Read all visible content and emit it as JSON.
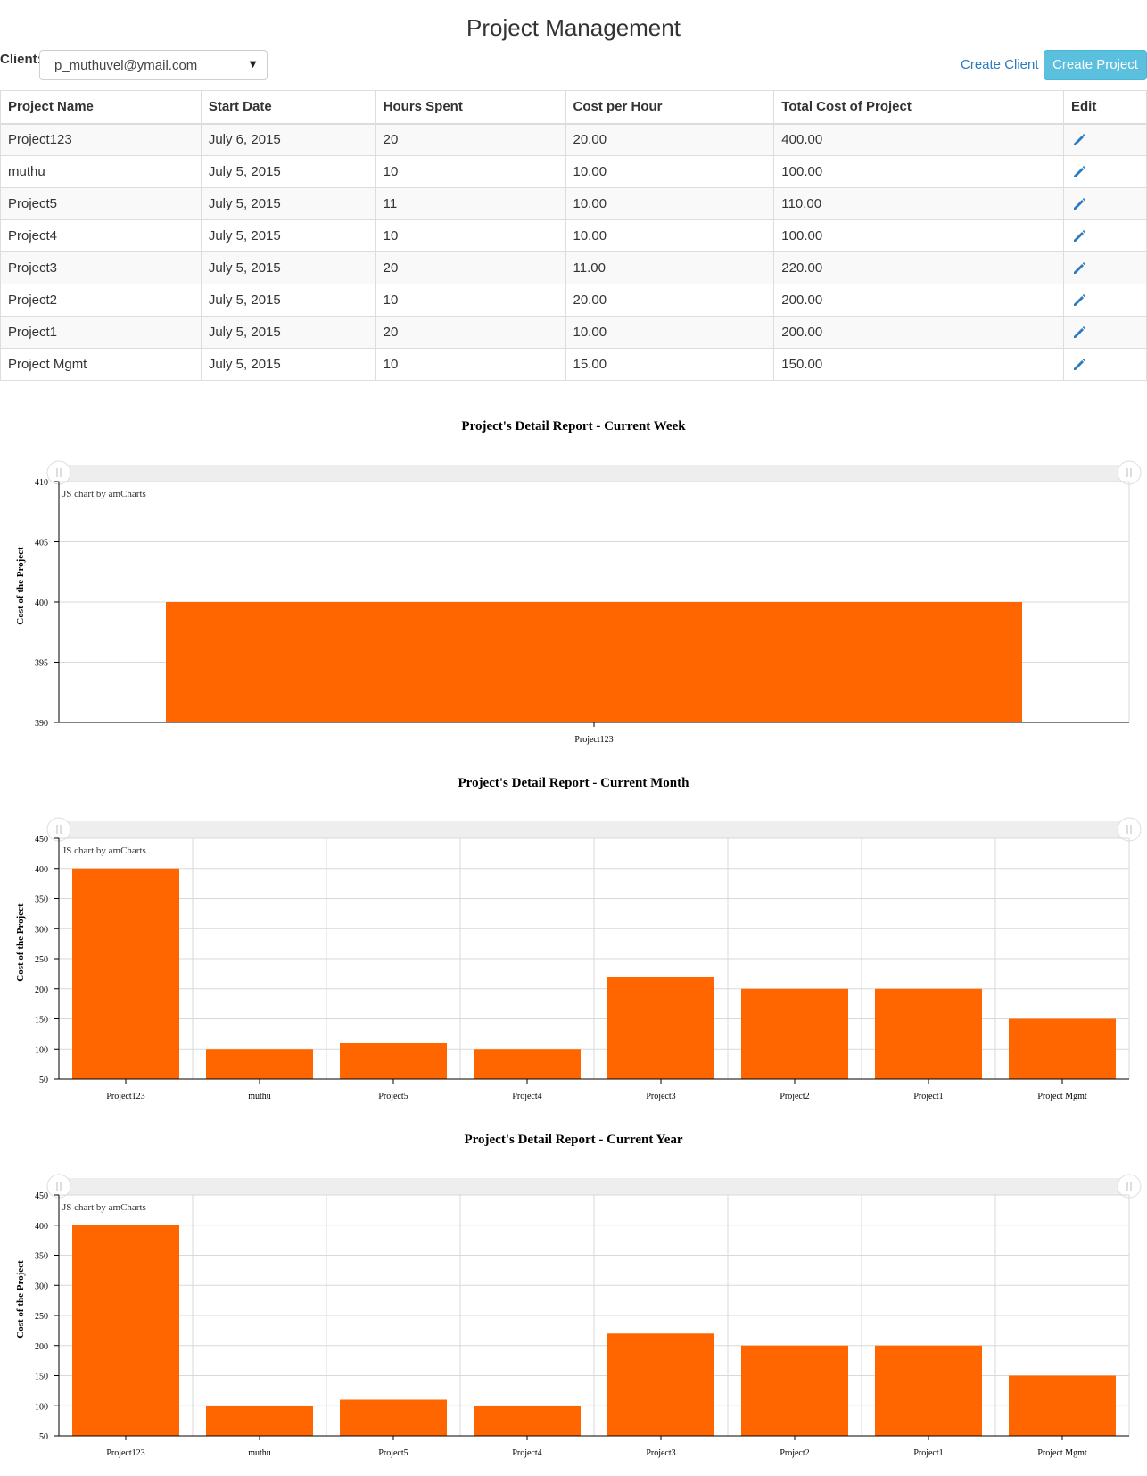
{
  "header": {
    "title": "Project Management"
  },
  "client": {
    "label": "Client:",
    "selected": "p_muthuvel@ymail.com"
  },
  "actions": {
    "create_client": "Create Client",
    "create_project": "Create Project"
  },
  "table": {
    "columns": [
      "Project Name",
      "Start Date",
      "Hours Spent",
      "Cost per Hour",
      "Total Cost of Project",
      "Edit"
    ],
    "rows": [
      [
        "Project123",
        "July 6, 2015",
        "20",
        "20.00",
        "400.00"
      ],
      [
        "muthu",
        "July 5, 2015",
        "10",
        "10.00",
        "100.00"
      ],
      [
        "Project5",
        "July 5, 2015",
        "11",
        "10.00",
        "110.00"
      ],
      [
        "Project4",
        "July 5, 2015",
        "10",
        "10.00",
        "100.00"
      ],
      [
        "Project3",
        "July 5, 2015",
        "20",
        "11.00",
        "220.00"
      ],
      [
        "Project2",
        "July 5, 2015",
        "10",
        "20.00",
        "200.00"
      ],
      [
        "Project1",
        "July 5, 2015",
        "20",
        "10.00",
        "200.00"
      ],
      [
        "Project Mgmt",
        "July 5, 2015",
        "10",
        "15.00",
        "150.00"
      ]
    ],
    "edit_icon": "pencil-icon"
  },
  "colors": {
    "bar": "#ff6600",
    "accent": "#5bc0de",
    "link": "#2a7bbf"
  },
  "chart_data": [
    {
      "type": "bar",
      "title": "Project's Detail Report - Current Week",
      "ylabel": "Cost of the Project",
      "credit": "JS chart by amCharts",
      "categories": [
        "Project123"
      ],
      "values": [
        400
      ],
      "ylim": [
        390,
        410
      ],
      "yticks": [
        390,
        395,
        400,
        405,
        410
      ],
      "grid": true
    },
    {
      "type": "bar",
      "title": "Project's Detail Report - Current Month",
      "ylabel": "Cost of the Project",
      "credit": "JS chart by amCharts",
      "categories": [
        "Project123",
        "muthu",
        "Project5",
        "Project4",
        "Project3",
        "Project2",
        "Project1",
        "Project Mgmt"
      ],
      "values": [
        400,
        100,
        110,
        100,
        220,
        200,
        200,
        150
      ],
      "ylim": [
        50,
        450
      ],
      "yticks": [
        50,
        100,
        150,
        200,
        250,
        300,
        350,
        400,
        450
      ],
      "grid": true
    },
    {
      "type": "bar",
      "title": "Project's Detail Report - Current Year",
      "ylabel": "Cost of the Project",
      "credit": "JS chart by amCharts",
      "categories": [
        "Project123",
        "muthu",
        "Project5",
        "Project4",
        "Project3",
        "Project2",
        "Project1",
        "Project Mgmt"
      ],
      "values": [
        400,
        100,
        110,
        100,
        220,
        200,
        200,
        150
      ],
      "ylim": [
        50,
        450
      ],
      "yticks": [
        50,
        100,
        150,
        200,
        250,
        300,
        350,
        400,
        450
      ],
      "grid": true
    }
  ]
}
